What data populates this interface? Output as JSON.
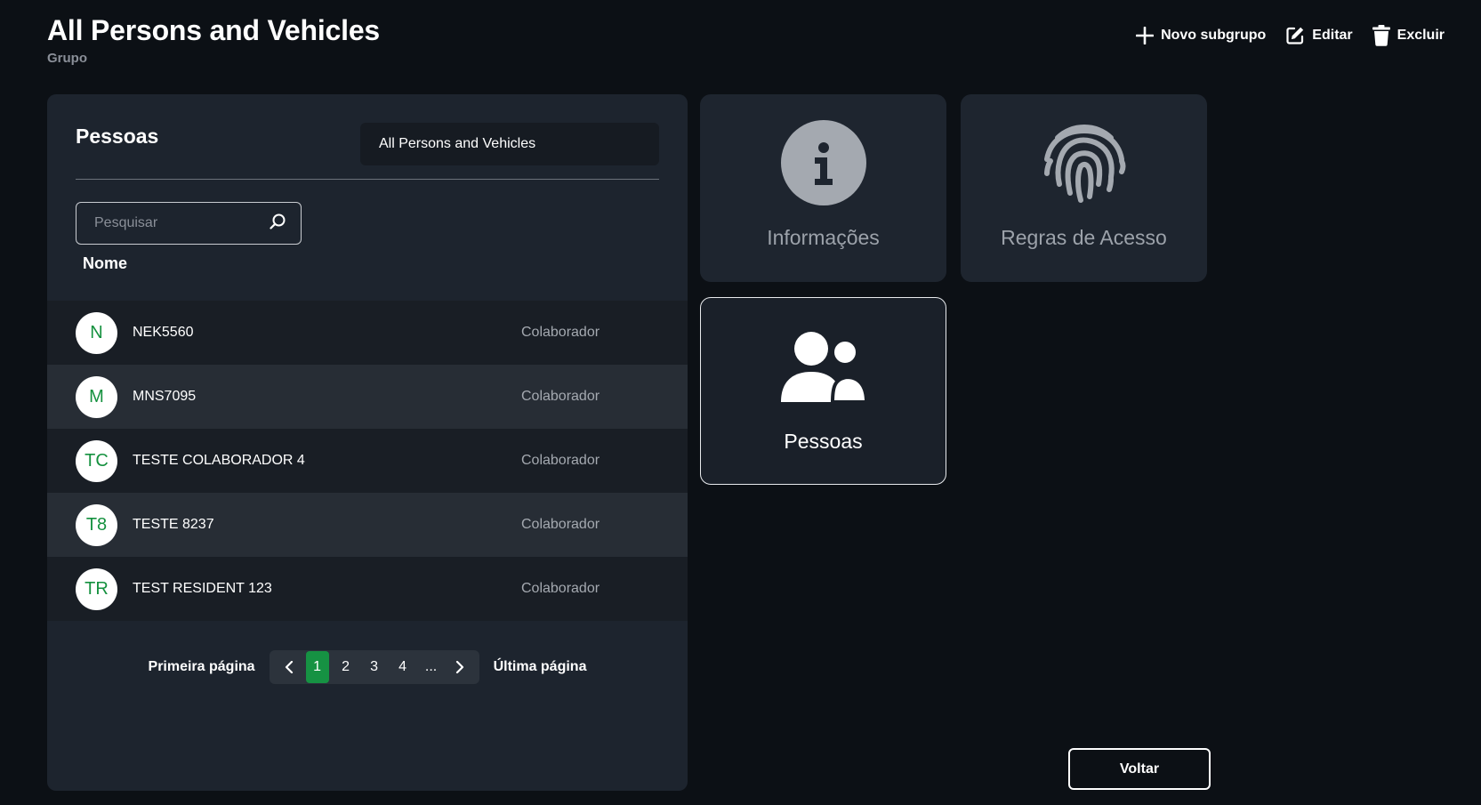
{
  "header": {
    "title": "All Persons and Vehicles",
    "subtitle": "Grupo",
    "actions": {
      "new_subgroup": "Novo subgrupo",
      "edit": "Editar",
      "delete": "Excluir"
    }
  },
  "people_panel": {
    "title": "Pessoas",
    "group_select_value": "All Persons and Vehicles",
    "search_placeholder": "Pesquisar",
    "column_name": "Nome",
    "rows": [
      {
        "initials": "N",
        "name": "NEK5560",
        "role": "Colaborador"
      },
      {
        "initials": "M",
        "name": "MNS7095",
        "role": "Colaborador"
      },
      {
        "initials": "TC",
        "name": "TESTE COLABORADOR 4",
        "role": "Colaborador"
      },
      {
        "initials": "T8",
        "name": "TESTE 8237",
        "role": "Colaborador"
      },
      {
        "initials": "TR",
        "name": "TEST RESIDENT 123",
        "role": "Colaborador"
      }
    ],
    "pagination": {
      "first": "Primeira página",
      "last": "Última página",
      "pages": [
        "1",
        "2",
        "3",
        "4",
        "..."
      ],
      "current": "1"
    }
  },
  "tiles": {
    "info": {
      "label": "Informações",
      "icon": "info-icon"
    },
    "access_rules": {
      "label": "Regras de Acesso",
      "icon": "fingerprint-icon"
    },
    "people": {
      "label": "Pessoas",
      "icon": "users-icon"
    }
  },
  "back_button": "Voltar",
  "colors": {
    "background": "#0c1015",
    "panel": "#1d242e",
    "accent_green": "#169243",
    "avatar_text": "#15913f"
  }
}
